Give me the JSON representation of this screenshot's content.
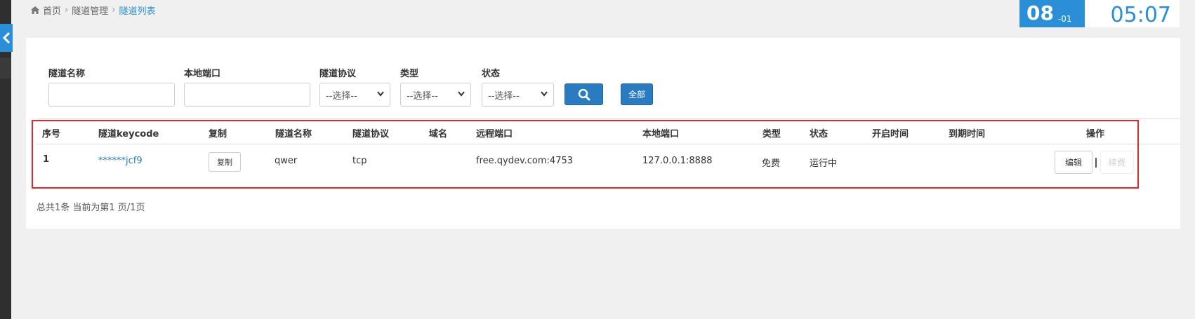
{
  "breadcrumb": {
    "home": "首页",
    "section": "隧道管理",
    "current": "隧道列表"
  },
  "clock": {
    "day": "08",
    "month": "-01",
    "time": "05:07"
  },
  "filters": {
    "tunnel_name_label": "隧道名称",
    "local_port_label": "本地端口",
    "protocol_label": "隧道协议",
    "protocol_value": "--选择--",
    "type_label": "类型",
    "type_value": "--选择--",
    "status_label": "状态",
    "status_value": "--选择--",
    "all_button": "全部"
  },
  "table": {
    "headers": [
      "序号",
      "隧道keycode",
      "复制",
      "隧道名称",
      "隧道协议",
      "域名",
      "远程端口",
      "本地端口",
      "类型",
      "状态",
      "开启时间",
      "到期时间",
      "操作"
    ],
    "rows": [
      {
        "index": "1",
        "keycode": "******jcf9",
        "copy": "复制",
        "name": "qwer",
        "protocol": "tcp",
        "domain": "",
        "remote_port": "free.qydev.com:4753",
        "local_port": "127.0.0.1:8888",
        "type": "免费",
        "status": "运行中",
        "start_time": "",
        "expire_time": "",
        "edit": "编辑",
        "renew": "续费"
      }
    ]
  },
  "pagination": {
    "summary": "总共1条 当前为第1 页/1页"
  },
  "colors": {
    "accent": "#2a8fd6",
    "highlight": "#e0282c"
  }
}
